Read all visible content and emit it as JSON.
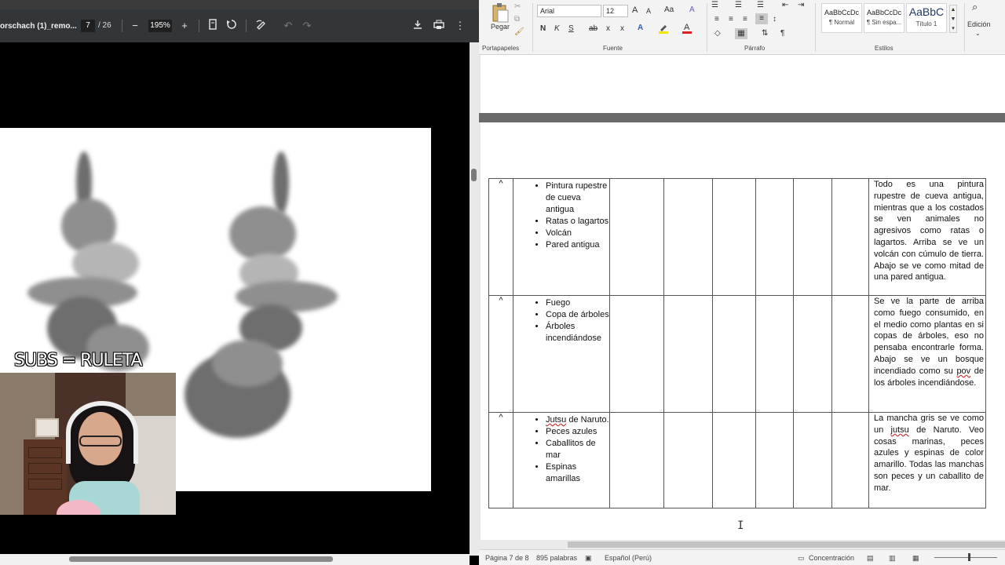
{
  "pdf": {
    "title": "orschach (1)_remo...",
    "page_current": "7",
    "page_total": "/ 26",
    "zoom": "195%",
    "icons": [
      "minus-icon",
      "plus-icon",
      "fit-page-icon",
      "rotate-icon",
      "draw-icon",
      "undo-icon",
      "redo-icon",
      "download-icon",
      "print-icon",
      "more-icon"
    ]
  },
  "overlay": {
    "subs_text": "SUBS = RULETA"
  },
  "ribbon": {
    "paste_label": "Pegar",
    "clipboard_label": "Portapapeles",
    "font_label": "Fuente",
    "paragraph_label": "Párrafo",
    "styles_label": "Estilos",
    "editing_label": "Edición",
    "font_name": "Arial",
    "font_size": "12",
    "grow_font": "A",
    "shrink_font": "A",
    "case_label": "Aa",
    "bold": "N",
    "italic": "K",
    "underline": "S",
    "strike": "ab",
    "subscript": "x",
    "superscript": "x",
    "styles": [
      {
        "sample": "AaBbCcDc",
        "name": "¶ Normal"
      },
      {
        "sample": "AaBbCcDc",
        "name": "¶ Sin espa..."
      },
      {
        "sample": "AaBbC",
        "name": "Título 1"
      }
    ]
  },
  "table": {
    "rows": [
      {
        "mark": "^",
        "items": [
          "Pintura rupestre de cueva antigua",
          "Ratas o lagartos",
          "Volcán",
          "Pared antigua"
        ],
        "description": "Todo es una pintura rupestre de cueva antigua, mientras que a los costados se ven animales no agresivos como ratas o lagartos. Arriba se ve un volcán con cúmulo de tierra. Abajo se ve como mitad de una pared antigua."
      },
      {
        "mark": "^",
        "items": [
          "Fuego",
          "Copa de árboles",
          "Árboles incendiándose"
        ],
        "description_pre": "Se ve la parte de arriba como fuego consumido, en el medio como plantas en si copas de árboles, eso no pensaba encontrarle forma. Abajo se ve un bosque incendiado como su ",
        "description_err": "pov",
        "description_post": " de los árboles incendiándose."
      },
      {
        "mark": "^",
        "items_err": "Jutsu",
        "items_first_post": " de Naruto.",
        "items": [
          "Peces azules",
          "Caballitos de mar",
          "Espinas amarillas"
        ],
        "description_pre": "La mancha gris se ve como un ",
        "description_err": "jutsu",
        "description_post": " de Naruto. Veo cosas marinas, peces azules y espinas de color amarillo. Todas las manchas son peces y un caballito de mar."
      }
    ]
  },
  "status": {
    "page": "Página 7 de 8",
    "words": "895 palabras",
    "language": "Español (Perú)",
    "focus": "Concentración"
  },
  "colors": {
    "pdf_toolbar": "#323639",
    "word_ribbon": "#f3f3f3",
    "page_gap": "#6a6a6a",
    "spell_error": "#d03030"
  }
}
